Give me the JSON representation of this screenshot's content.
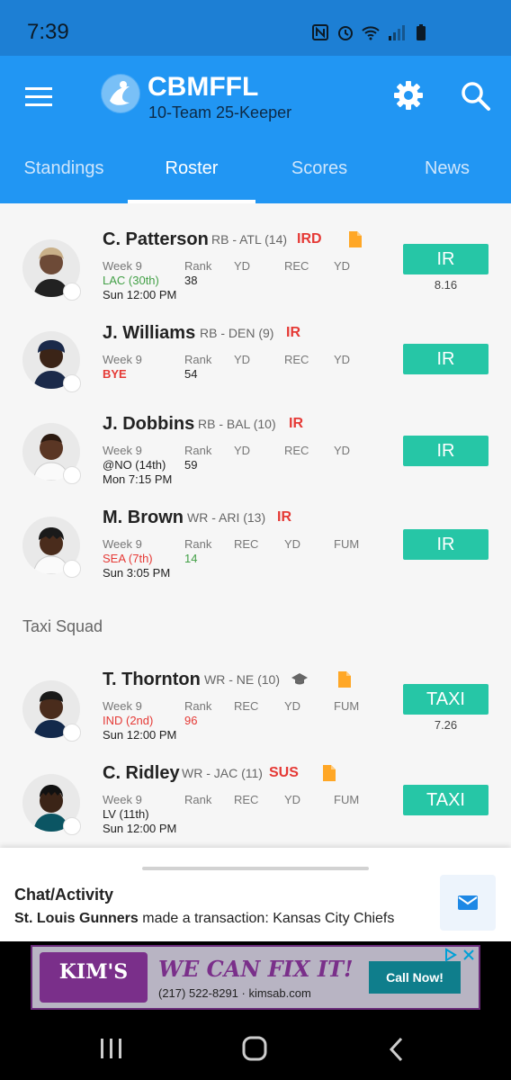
{
  "status_bar": {
    "time": "7:39",
    "icons": [
      "nfc-icon",
      "alarm-icon",
      "wifi-icon",
      "signal-icon",
      "battery-icon"
    ]
  },
  "app": {
    "title": "CBMFFL",
    "subtitle": "10-Team 25-Keeper"
  },
  "tabs": [
    {
      "label": "Standings",
      "active": false
    },
    {
      "label": "Roster",
      "active": true
    },
    {
      "label": "Scores",
      "active": false
    },
    {
      "label": "News",
      "active": false
    }
  ],
  "players": [
    {
      "name": "C. Patterson",
      "position": "RB - ATL (14)",
      "status": "IRD",
      "has_note": true,
      "week": "Week 9",
      "opponent": "LAC (30th)",
      "opponent_color": "green",
      "game_time": "Sun 12:00 PM",
      "columns": [
        "Rank",
        "YD",
        "REC",
        "YD"
      ],
      "rank": "38",
      "rank_color": "default",
      "action": "IR",
      "points": "8.16"
    },
    {
      "name": "J. Williams",
      "position": "RB - DEN (9)",
      "status": "IR",
      "week": "Week 9",
      "opponent": "BYE",
      "opponent_color": "red",
      "game_time": "",
      "columns": [
        "Rank",
        "YD",
        "REC",
        "YD"
      ],
      "rank": "54",
      "rank_color": "default",
      "action": "IR"
    },
    {
      "name": "J. Dobbins",
      "position": "RB - BAL (10)",
      "status": "IR",
      "week": "Week 9",
      "opponent": "@NO (14th)",
      "opponent_color": "default",
      "game_time": "Mon 7:15 PM",
      "columns": [
        "Rank",
        "YD",
        "REC",
        "YD"
      ],
      "rank": "59",
      "rank_color": "default",
      "action": "IR"
    },
    {
      "name": "M. Brown",
      "position": "WR - ARI (13)",
      "status": "IR",
      "week": "Week 9",
      "opponent": "SEA (7th)",
      "opponent_color": "red",
      "game_time": "Sun 3:05 PM",
      "columns": [
        "Rank",
        "REC",
        "YD",
        "FUM"
      ],
      "rank": "14",
      "rank_color": "green",
      "action": "IR"
    }
  ],
  "taxi_section": {
    "title": "Taxi Squad",
    "players": [
      {
        "name": "T. Thornton",
        "position": "WR - NE (10)",
        "status": "",
        "has_cap": true,
        "has_note": true,
        "week": "Week 9",
        "opponent": "IND (2nd)",
        "opponent_color": "red",
        "game_time": "Sun 12:00 PM",
        "columns": [
          "Rank",
          "REC",
          "YD",
          "FUM"
        ],
        "rank": "96",
        "rank_color": "red",
        "action": "TAXI",
        "points": "7.26"
      },
      {
        "name": "C. Ridley",
        "position": "WR - JAC (11)",
        "status": "SUS",
        "has_note": true,
        "week": "Week 9",
        "opponent": "LV (11th)",
        "opponent_color": "default",
        "game_time": "Sun 12:00 PM",
        "columns": [
          "Rank",
          "REC",
          "YD",
          "FUM"
        ],
        "rank": "",
        "rank_color": "default",
        "action": "TAXI"
      }
    ]
  },
  "chat": {
    "title": "Chat/Activity",
    "actor": "St. Louis Gunners",
    "message": " made a transaction: Kansas City Chiefs"
  },
  "ad": {
    "brand": "KIM'S",
    "headline": "WE CAN FIX IT!",
    "phone": "(217) 522-8291",
    "site": "kimsab.com",
    "cta": "Call Now!"
  },
  "colors": {
    "app_bar": "#2196f3",
    "status_bar": "#1d7fd4",
    "action_button": "#26c6a6",
    "status_red": "#e53935",
    "positive_green": "#43a047",
    "note_orange": "#ffa726"
  }
}
